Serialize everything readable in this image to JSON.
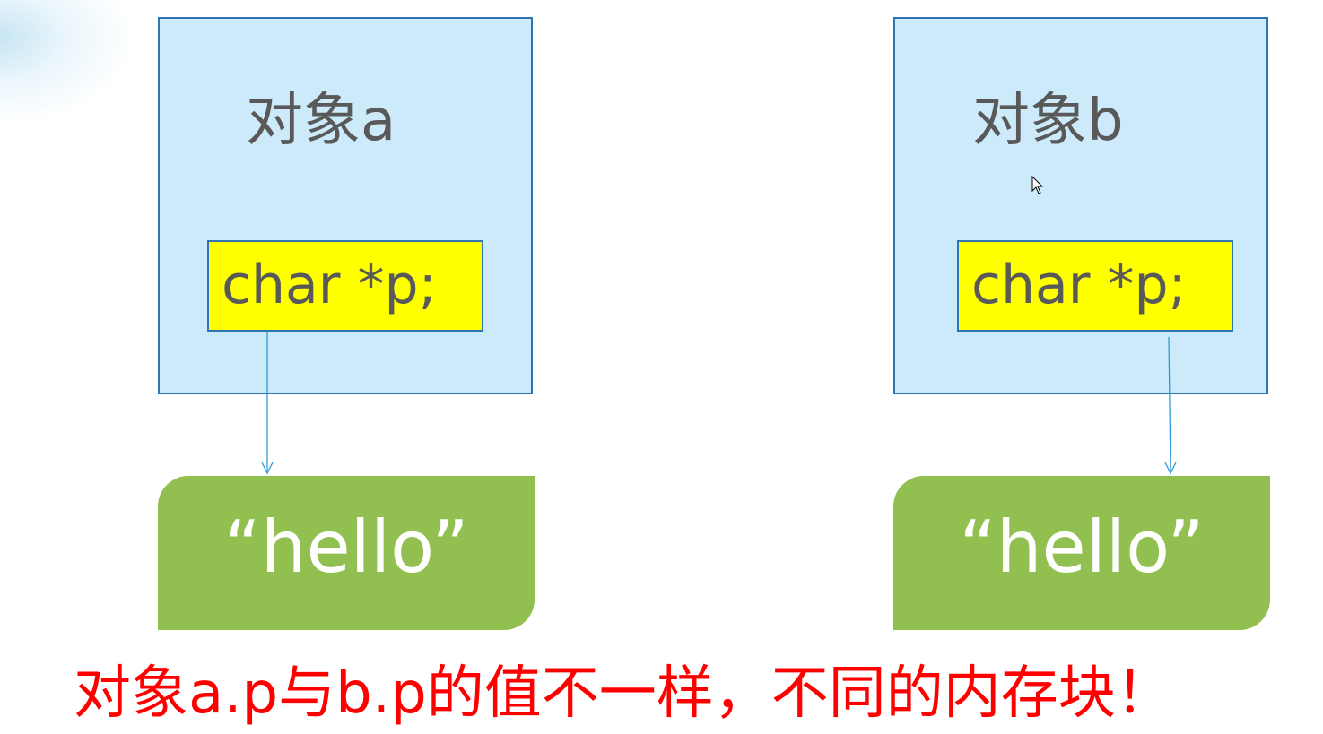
{
  "objects": [
    {
      "label": "对象a",
      "field": "char *p;",
      "string": "“hello”"
    },
    {
      "label": "对象b",
      "field": "char *p;",
      "string": "“hello”"
    }
  ],
  "caption": "对象a.p与b.p的值不一样，不同的内存块！",
  "colors": {
    "object_fill": "#cdeafa",
    "object_border": "#2e75b6",
    "field_fill": "#ffff00",
    "string_fill": "#92c050",
    "arrow": "#2e9bd6",
    "caption": "#ff0000",
    "label_text": "#595959"
  }
}
